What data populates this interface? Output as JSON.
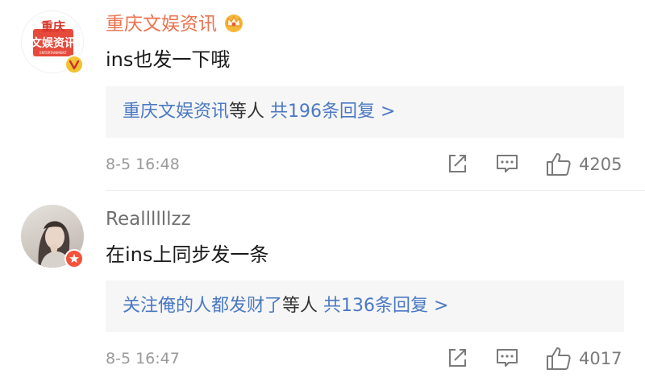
{
  "comments": [
    {
      "username": "重庆文娱资讯",
      "avatar_text_line1": "重庆",
      "avatar_text_line2": "文娱资讯",
      "avatar_text_small": "ENTERTAINMENT",
      "text": "ins也发一下哦",
      "reply_names": "重庆文娱资讯",
      "reply_mid": "等人",
      "reply_count": "共196条回复 >",
      "time": "8-5 16:48",
      "likes": "4205"
    },
    {
      "username": "Reallllllzz",
      "text": "在ins上同步发一条",
      "reply_names": "关注俺的人都发财了",
      "reply_mid": "等人",
      "reply_count": "共136条回复 >",
      "time": "8-5 16:47",
      "likes": "4017"
    }
  ],
  "colors": {
    "accent_orange": "#eb7350",
    "link_blue": "#4b79c3",
    "badge_gold": "#f2c230",
    "badge_red": "#f4523b"
  },
  "icons": [
    "vip-crown-icon",
    "verified-v-icon",
    "star-badge-icon",
    "share-icon",
    "comment-icon",
    "like-icon"
  ]
}
